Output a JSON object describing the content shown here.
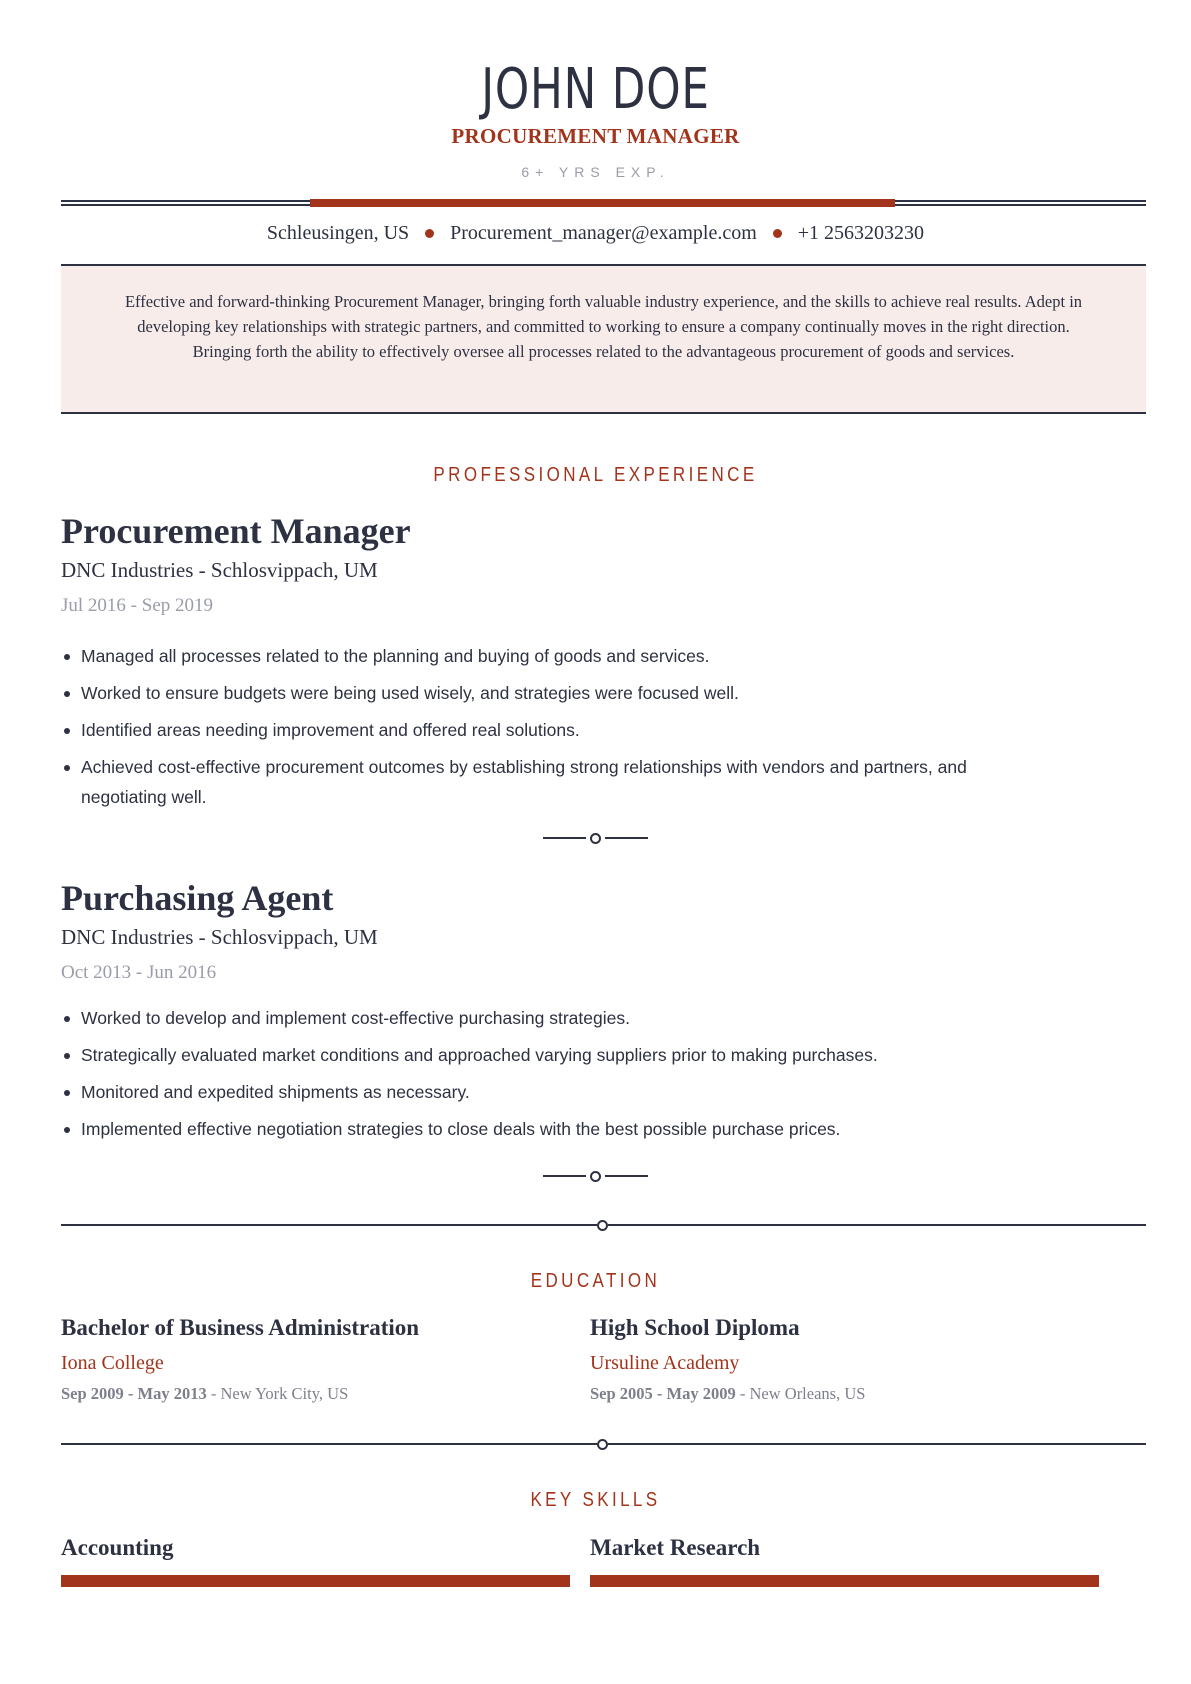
{
  "header": {
    "name": "JOHN DOE",
    "headline": "PROCUREMENT MANAGER",
    "experience": "6+ YRS EXP."
  },
  "contact": {
    "location": "Schleusingen, US",
    "email": "Procurement_manager@example.com",
    "phone": "+1 2563203230"
  },
  "summary": "Effective and forward-thinking Procurement Manager, bringing forth valuable industry experience, and the skills to achieve real results. Adept in developing key relationships with strategic partners, and committed to working to ensure a company continually moves in the right direction. Bringing forth the ability to effectively oversee all processes related to the advantageous procurement of goods and services.",
  "sections": {
    "experience": "PROFESSIONAL EXPERIENCE",
    "education": "EDUCATION",
    "skills": "KEY SKILLS"
  },
  "jobs": [
    {
      "title": "Procurement Manager",
      "company": "DNC Industries - Schlosvippach, UM",
      "dates": "Jul 2016 - Sep 2019",
      "bullets": [
        "Managed all processes related to the planning and buying of goods and services.",
        "Worked to ensure budgets were being used wisely, and strategies were focused well.",
        "Identified areas needing improvement and offered real solutions.",
        "Achieved cost-effective procurement outcomes by establishing strong relationships with vendors and partners, and negotiating well."
      ]
    },
    {
      "title": "Purchasing Agent",
      "company": "DNC Industries - Schlosvippach, UM",
      "dates": "Oct 2013 - Jun 2016",
      "bullets": [
        "Worked to develop and implement cost-effective purchasing strategies.",
        "Strategically evaluated market conditions and approached varying suppliers prior to making purchases.",
        "Monitored and expedited shipments as necessary.",
        "Implemented effective negotiation strategies to close deals with the best possible purchase prices."
      ]
    }
  ],
  "education": [
    {
      "degree": "Bachelor of Business Administration",
      "school": "Iona College",
      "dates": "Sep 2009 - May 2013",
      "location": " - New York City, US"
    },
    {
      "degree": "High School Diploma",
      "school": "Ursuline Academy",
      "dates": "Sep 2005 - May 2009",
      "location": " - New Orleans, US"
    }
  ],
  "skills": [
    {
      "name": "Accounting",
      "level": 1.0
    },
    {
      "name": "Market Research",
      "level": 1.0
    }
  ],
  "colors": {
    "accent": "#a3341c",
    "text": "#2d3142",
    "muted": "#9a9ca8",
    "summary_bg": "#f7ecea"
  }
}
